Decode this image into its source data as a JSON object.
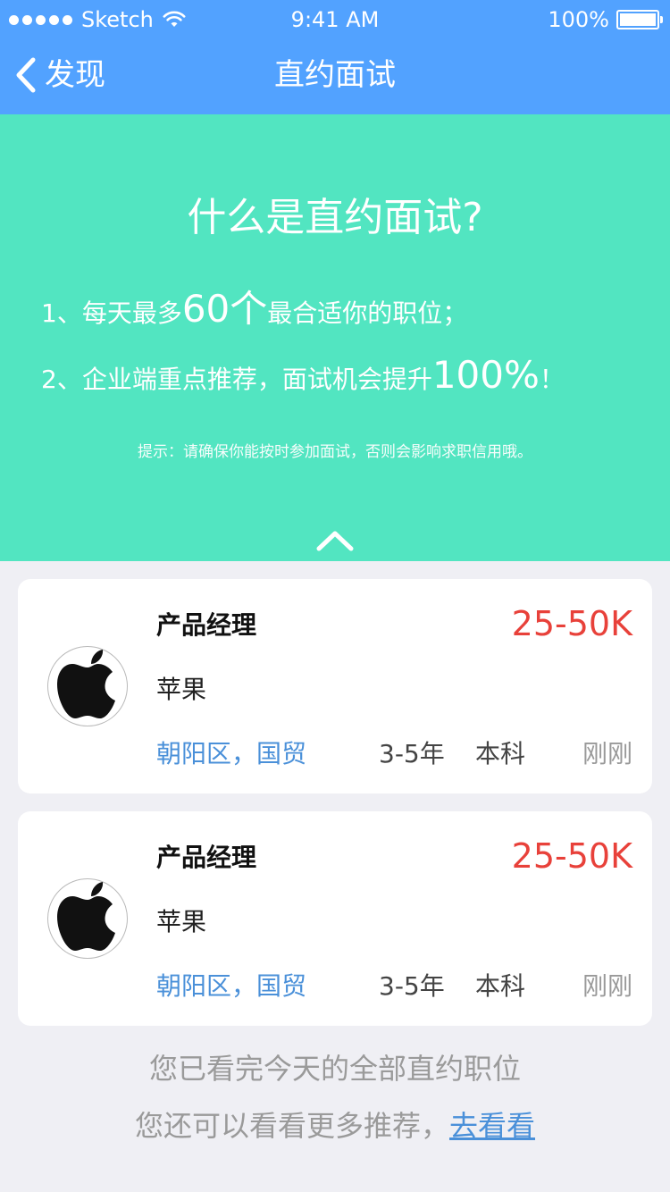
{
  "status_bar": {
    "carrier": "Sketch",
    "time": "9:41 AM",
    "battery": "100%",
    "icons": [
      "signal-dots-icon",
      "wifi-icon",
      "battery-icon"
    ]
  },
  "nav": {
    "back_label": "发现",
    "title": "直约面试",
    "back_icon": "chevron-left-icon"
  },
  "info": {
    "title": "什么是直约面试?",
    "line1": {
      "prefix": "1、每天最多",
      "highlight": "60个",
      "suffix": "最合适你的职位；"
    },
    "line2": {
      "prefix": "2、企业端重点推荐，面试机会提升",
      "highlight": "100%",
      "suffix": "！"
    },
    "tip": "提示：请确保你能按时参加面试，否则会影响求职信用哦。",
    "collapse_icon": "chevron-up-icon"
  },
  "jobs": [
    {
      "title": "产品经理",
      "salary": "25-50K",
      "company": "苹果",
      "location": "朝阳区，国贸",
      "experience": "3-5年",
      "education": "本科",
      "posted": "刚刚",
      "logo_icon": "apple-logo-icon"
    },
    {
      "title": "产品经理",
      "salary": "25-50K",
      "company": "苹果",
      "location": "朝阳区，国贸",
      "experience": "3-5年",
      "education": "本科",
      "posted": "刚刚",
      "logo_icon": "apple-logo-icon"
    }
  ],
  "footer": {
    "line1": "您已看完今天的全部直约职位",
    "line2_prefix": "您还可以看看更多推荐，",
    "line2_link": "去看看"
  },
  "colors": {
    "header_blue": "#52a2ff",
    "info_green": "#52e5c1",
    "salary_red": "#e8413a",
    "link_blue": "#4a90d9",
    "background": "#efeff4"
  }
}
